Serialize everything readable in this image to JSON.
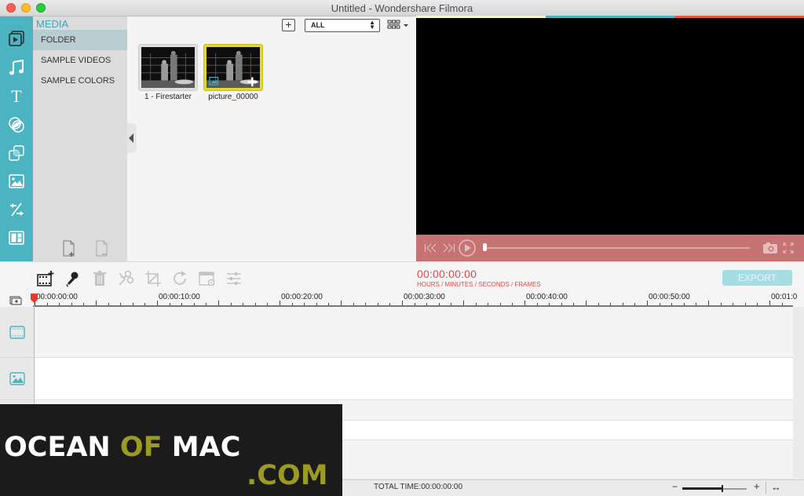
{
  "window": {
    "title": "Untitled - Wondershare Filmora"
  },
  "rail": {
    "items": [
      {
        "name": "media",
        "icon": "media-icon",
        "active": true
      },
      {
        "name": "music",
        "icon": "music-icon"
      },
      {
        "name": "text",
        "icon": "text-icon"
      },
      {
        "name": "filters",
        "icon": "filters-icon"
      },
      {
        "name": "overlays",
        "icon": "overlays-icon"
      },
      {
        "name": "elements",
        "icon": "image-icon"
      },
      {
        "name": "transitions",
        "icon": "transitions-icon"
      },
      {
        "name": "split-screen",
        "icon": "split-screen-icon"
      }
    ]
  },
  "media": {
    "header": "MEDIA",
    "items": [
      {
        "label": "FOLDER",
        "active": true
      },
      {
        "label": "SAMPLE VIDEOS"
      },
      {
        "label": "SAMPLE COLORS"
      }
    ],
    "filter": {
      "selected": "ALL"
    },
    "clips": [
      {
        "label": "1 - Firestarter",
        "selected": false
      },
      {
        "label": "picture_00000",
        "selected": true
      }
    ]
  },
  "preview": {
    "bar_colors": [
      "#f7f2d3",
      "#4cb4c1",
      "#dd5a45"
    ]
  },
  "toolbar": {
    "timecode": "00:00:00:00",
    "timecode_hint": "HOURS / MINUTES / SECONDS / FRAMES",
    "export_label": "EXPORT"
  },
  "ruler": {
    "labels": [
      "00:00:00:00",
      "00:00:10:00",
      "00:00:20:00",
      "00:00:30:00",
      "00:00:40:00",
      "00:00:50:00",
      "00:01:0"
    ]
  },
  "tracks": [
    {
      "type": "video",
      "icon": "film-icon"
    },
    {
      "type": "image",
      "icon": "image-icon"
    },
    {
      "type": "text",
      "icon": "text-icon"
    },
    {
      "type": "audio",
      "icon": "music-icon"
    },
    {
      "type": "audio2",
      "icon": "music-icon"
    }
  ],
  "status": {
    "total_time": "TOTAL TIME:00:00:00:00",
    "zoom_level": 0.62
  },
  "watermark": {
    "word1": "OCEAN",
    "word2": "OF",
    "word3": "MAC",
    "suffix": ".COM"
  }
}
